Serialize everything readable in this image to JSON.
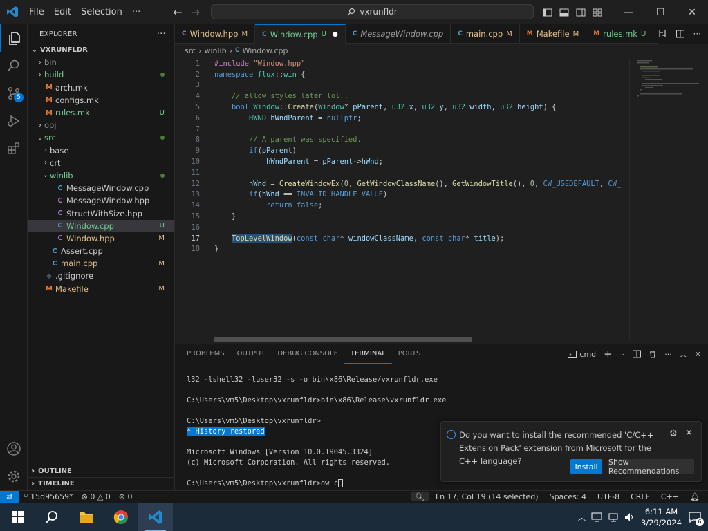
{
  "titlebar": {
    "menu": [
      "File",
      "Edit",
      "Selection"
    ],
    "more": "···",
    "search_text": "vxrunfldr"
  },
  "activity_badge": "5",
  "explorer": {
    "header": "EXPLORER",
    "root": "VXRUNFLDR",
    "items": [
      {
        "label": "bin",
        "type": "folder",
        "open": false,
        "depth": 1,
        "color": "#8b8b8b",
        "status": ""
      },
      {
        "label": "build",
        "type": "folder",
        "open": false,
        "depth": 1,
        "color": "#73c991",
        "status": "dot"
      },
      {
        "label": "arch.mk",
        "type": "file",
        "icon": "M",
        "icon_color": "#e37933",
        "depth": 1,
        "color": "#cccccc",
        "status": ""
      },
      {
        "label": "configs.mk",
        "type": "file",
        "icon": "M",
        "icon_color": "#e37933",
        "depth": 1,
        "color": "#cccccc",
        "status": ""
      },
      {
        "label": "rules.mk",
        "type": "file",
        "icon": "M",
        "icon_color": "#e37933",
        "depth": 1,
        "color": "#73c991",
        "status": "U"
      },
      {
        "label": "obj",
        "type": "folder",
        "open": false,
        "depth": 1,
        "color": "#8b8b8b",
        "status": ""
      },
      {
        "label": "src",
        "type": "folder",
        "open": true,
        "depth": 1,
        "color": "#73c991",
        "status": "dot"
      },
      {
        "label": "base",
        "type": "folder",
        "open": false,
        "depth": 2,
        "color": "#cccccc",
        "status": ""
      },
      {
        "label": "crt",
        "type": "folder",
        "open": false,
        "depth": 2,
        "color": "#cccccc",
        "status": ""
      },
      {
        "label": "winlib",
        "type": "folder",
        "open": true,
        "depth": 2,
        "color": "#73c991",
        "status": "dot"
      },
      {
        "label": "MessageWindow.cpp",
        "type": "file",
        "icon": "C",
        "icon_color": "#519aba",
        "depth": 3,
        "color": "#cccccc",
        "status": ""
      },
      {
        "label": "MessageWindow.hpp",
        "type": "file",
        "icon": "C",
        "icon_color": "#a074c4",
        "depth": 3,
        "color": "#cccccc",
        "status": ""
      },
      {
        "label": "StructWithSize.hpp",
        "type": "file",
        "icon": "C",
        "icon_color": "#a074c4",
        "depth": 3,
        "color": "#cccccc",
        "status": ""
      },
      {
        "label": "Window.cpp",
        "type": "file",
        "icon": "C",
        "icon_color": "#519aba",
        "depth": 3,
        "color": "#73c991",
        "status": "U",
        "selected": true
      },
      {
        "label": "Window.hpp",
        "type": "file",
        "icon": "C",
        "icon_color": "#a074c4",
        "depth": 3,
        "color": "#e2c08d",
        "status": "M"
      },
      {
        "label": "Assert.cpp",
        "type": "file",
        "icon": "C",
        "icon_color": "#519aba",
        "depth": 2,
        "color": "#cccccc",
        "status": ""
      },
      {
        "label": "main.cpp",
        "type": "file",
        "icon": "C",
        "icon_color": "#519aba",
        "depth": 2,
        "color": "#e2c08d",
        "status": "M"
      },
      {
        "label": ".gitignore",
        "type": "file",
        "icon": "◆",
        "icon_color": "#41535b",
        "depth": 1,
        "color": "#cccccc",
        "status": ""
      },
      {
        "label": "Makefile",
        "type": "file",
        "icon": "M",
        "icon_color": "#e37933",
        "depth": 1,
        "color": "#e2c08d",
        "status": "M"
      }
    ],
    "outline": "OUTLINE",
    "timeline": "TIMELINE"
  },
  "tabs": [
    {
      "label": "Window.hpp",
      "status": "M",
      "icon_color": "#a074c4",
      "color": "#e2c08d",
      "active": false,
      "italic": false
    },
    {
      "label": "Window.cpp",
      "status": "U",
      "icon_color": "#519aba",
      "color": "#73c991",
      "active": true,
      "italic": false,
      "dirty": true
    },
    {
      "label": "MessageWindow.cpp",
      "status": "",
      "icon_color": "#519aba",
      "color": "#9d9d9d",
      "active": false,
      "italic": true
    },
    {
      "label": "main.cpp",
      "status": "M",
      "icon_color": "#519aba",
      "color": "#e2c08d",
      "active": false,
      "italic": false
    },
    {
      "label": "Makefile",
      "status": "M",
      "icon_color": "#e37933",
      "color": "#e2c08d",
      "active": false,
      "italic": false
    },
    {
      "label": "rules.mk",
      "status": "U",
      "icon_color": "#e37933",
      "color": "#73c991",
      "active": false,
      "italic": false
    }
  ],
  "breadcrumb": [
    "src",
    "winlib",
    "Window.cpp"
  ],
  "code": {
    "lines": [
      "#include \"Window.hpp\"",
      "namespace flux::win {",
      "",
      "    // allow styles later lol..",
      "    bool Window::Create(Window* pParent, u32 x, u32 y, u32 width, u32 height) {",
      "        HWND hWndParent = nullptr;",
      "",
      "        // A parent was specified.",
      "        if(pParent)",
      "            hWndParent = pParent->hWnd;",
      "",
      "        hWnd = CreateWindowEx(0, GetWindowClassName(), GetWindowTitle(), 0, CW_USEDEFAULT, CW_",
      "        if(hWnd == INVALID_HANDLE_VALUE)",
      "            return false;",
      "    }",
      "",
      "    TopLevelWindow(const char* windowClassName, const char* title);",
      "}"
    ],
    "current_line": 17
  },
  "panel": {
    "tabs": [
      "PROBLEMS",
      "OUTPUT",
      "DEBUG CONSOLE",
      "TERMINAL",
      "PORTS"
    ],
    "active_tab": "TERMINAL",
    "terminal_name": "cmd"
  },
  "terminal": {
    "l1": "l32 -lshell32 -luser32 -s -o bin\\x86\\Release/vxrunfldr.exe",
    "l2": "C:\\Users\\vm5\\Desktop\\vxrunfldr>bin\\x86\\Release\\vxrunfldr.exe",
    "l3": "C:\\Users\\vm5\\Desktop\\vxrunfldr>",
    "hist_star": "*",
    "hist_text": "History restored",
    "l5": "Microsoft Windows [Version 10.0.19045.3324]",
    "l6": "(c) Microsoft Corporation. All rights reserved.",
    "prompt": "C:\\Users\\vm5\\Desktop\\vxrunfldr>ow c"
  },
  "notification": {
    "message": "Do you want to install the recommended 'C/C++ Extension Pack' extension from Microsoft for the C++ language?",
    "install": "Install",
    "recommend": "Show Recommendations"
  },
  "statusbar": {
    "branch": "15d95659*",
    "errors": "0",
    "warnings": "0",
    "ports": "0",
    "position": "Ln 17, Col 19 (14 selected)",
    "spaces": "Spaces: 4",
    "encoding": "UTF-8",
    "eol": "CRLF",
    "language": "C++"
  },
  "taskbar": {
    "time": "6:11 AM",
    "date": "3/29/2024",
    "notif_count": "6"
  }
}
